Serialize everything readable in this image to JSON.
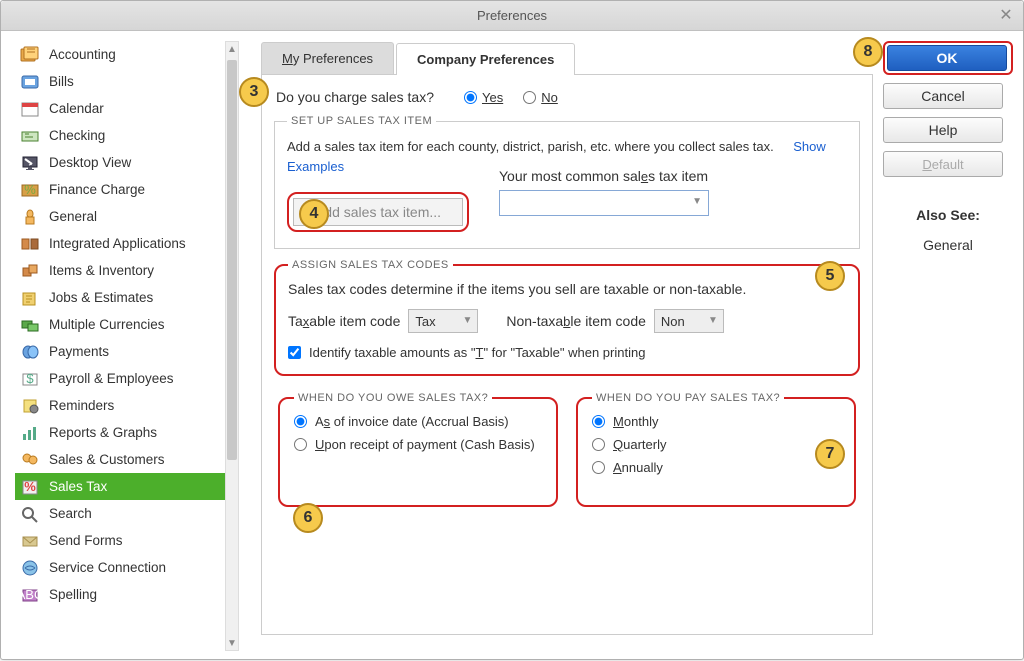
{
  "window": {
    "title": "Preferences"
  },
  "sidebar": {
    "items": [
      {
        "label": "Accounting",
        "icon": "accounting-icon",
        "sel": false
      },
      {
        "label": "Bills",
        "icon": "bills-icon",
        "sel": false
      },
      {
        "label": "Calendar",
        "icon": "calendar-icon",
        "sel": false
      },
      {
        "label": "Checking",
        "icon": "checking-icon",
        "sel": false
      },
      {
        "label": "Desktop View",
        "icon": "desktop-icon",
        "sel": false
      },
      {
        "label": "Finance Charge",
        "icon": "finance-icon",
        "sel": false
      },
      {
        "label": "General",
        "icon": "general-icon",
        "sel": false
      },
      {
        "label": "Integrated Applications",
        "icon": "apps-icon",
        "sel": false
      },
      {
        "label": "Items & Inventory",
        "icon": "items-icon",
        "sel": false
      },
      {
        "label": "Jobs & Estimates",
        "icon": "jobs-icon",
        "sel": false
      },
      {
        "label": "Multiple Currencies",
        "icon": "currencies-icon",
        "sel": false
      },
      {
        "label": "Payments",
        "icon": "payments-icon",
        "sel": false
      },
      {
        "label": "Payroll & Employees",
        "icon": "payroll-icon",
        "sel": false
      },
      {
        "label": "Reminders",
        "icon": "reminders-icon",
        "sel": false
      },
      {
        "label": "Reports & Graphs",
        "icon": "reports-icon",
        "sel": false
      },
      {
        "label": "Sales & Customers",
        "icon": "sales-icon",
        "sel": false
      },
      {
        "label": "Sales Tax",
        "icon": "tax-icon",
        "sel": true
      },
      {
        "label": "Search",
        "icon": "search-icon",
        "sel": false
      },
      {
        "label": "Send Forms",
        "icon": "send-icon",
        "sel": false
      },
      {
        "label": "Service Connection",
        "icon": "service-icon",
        "sel": false
      },
      {
        "label": "Spelling",
        "icon": "spelling-icon",
        "sel": false
      }
    ]
  },
  "tabs": {
    "my": "My Preferences",
    "company": "Company Preferences"
  },
  "main": {
    "charge_q": "Do you charge sales tax?",
    "yes": "Yes",
    "no": "No",
    "setup": {
      "legend": "SET UP SALES TAX ITEM",
      "text1": "Add a sales tax item for each county, district, parish, etc. where you collect sales tax.",
      "show_examples": "Show Examples",
      "add_btn": "Add sales tax item...",
      "common_label": "Your most common sales tax item",
      "common_value": ""
    },
    "assign": {
      "legend": "ASSIGN SALES TAX CODES",
      "text": "Sales tax codes determine if the items you sell are taxable or non-taxable.",
      "taxable_label": "Taxable item code",
      "taxable_value": "Tax",
      "nontaxable_label": "Non-taxable item code",
      "nontaxable_value": "Non",
      "identify": "Identify taxable amounts as \"T\" for \"Taxable\" when printing"
    },
    "owe": {
      "legend": "WHEN DO YOU OWE SALES TAX?",
      "opt1": "As of invoice date (Accrual Basis)",
      "opt2": "Upon receipt of payment (Cash Basis)"
    },
    "pay": {
      "legend": "WHEN DO YOU PAY SALES TAX?",
      "opt1": "Monthly",
      "opt2": "Quarterly",
      "opt3": "Annually"
    }
  },
  "right": {
    "ok": "OK",
    "cancel": "Cancel",
    "help": "Help",
    "default": "Default",
    "also_see": "Also See:",
    "also_item": "General"
  },
  "callouts": {
    "c3": "3",
    "c4": "4",
    "c5": "5",
    "c6": "6",
    "c7": "7",
    "c8": "8"
  }
}
